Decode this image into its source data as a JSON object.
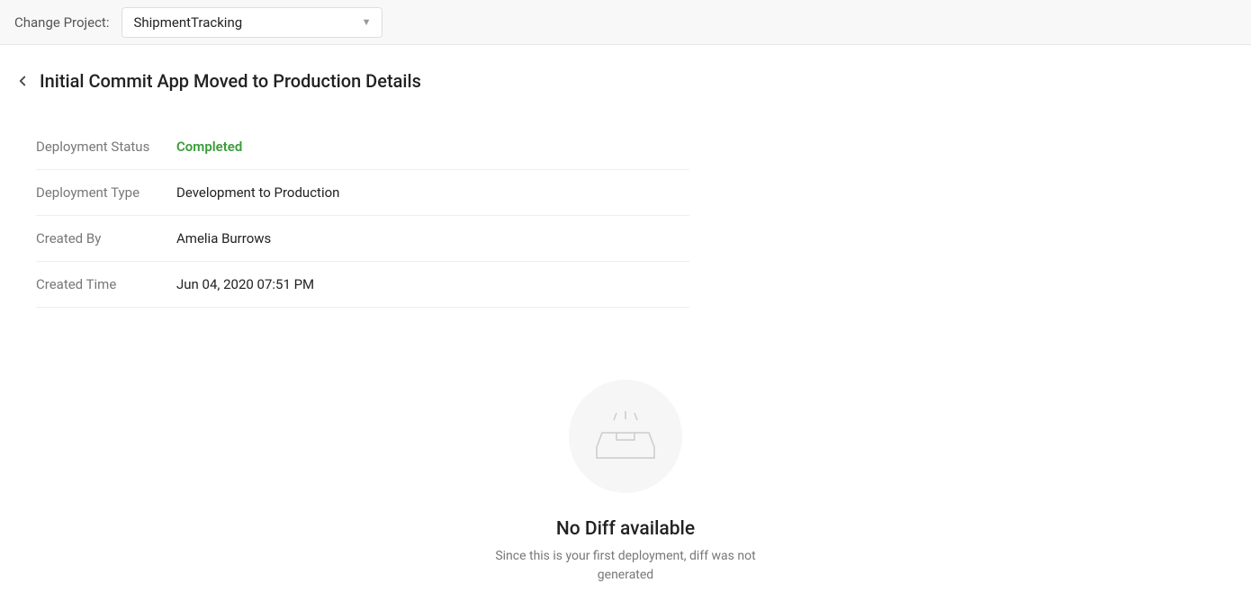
{
  "topbar": {
    "change_project_label": "Change Project:",
    "selected_project": "ShipmentTracking"
  },
  "page": {
    "title": "Initial Commit App Moved to Production Details"
  },
  "details": {
    "labels": {
      "status": "Deployment Status",
      "type": "Deployment Type",
      "created_by": "Created By",
      "created_time": "Created Time"
    },
    "values": {
      "status": "Completed",
      "type": "Development to Production",
      "created_by": "Amelia Burrows",
      "created_time": "Jun 04, 2020 07:51 PM"
    }
  },
  "empty_state": {
    "title": "No Diff available",
    "description": "Since this is your first deployment, diff was not generated"
  }
}
